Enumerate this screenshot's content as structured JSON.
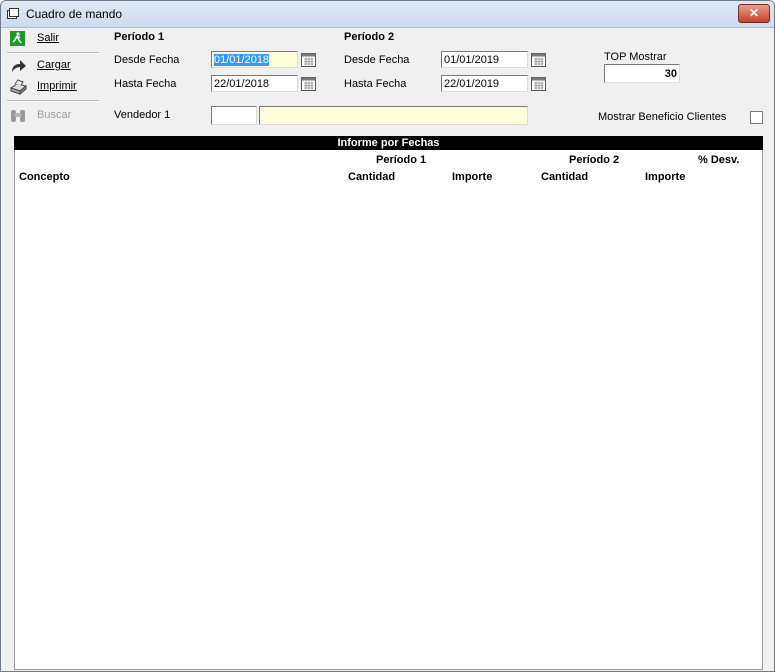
{
  "window": {
    "title": "Cuadro de mando",
    "close_label": "✕"
  },
  "toolbar": {
    "salir": "Salir",
    "cargar": "Cargar",
    "imprimir": "Imprimir",
    "buscar": "Buscar"
  },
  "periodo1": {
    "heading": "Período 1",
    "desde_label": "Desde Fecha",
    "desde_value": "01/01/2018",
    "hasta_label": "Hasta Fecha",
    "hasta_value": "22/01/2018"
  },
  "periodo2": {
    "heading": "Período 2",
    "desde_label": "Desde Fecha",
    "desde_value": "01/01/2019",
    "hasta_label": "Hasta Fecha",
    "hasta_value": "22/01/2019"
  },
  "top": {
    "label": "TOP Mostrar",
    "value": "30"
  },
  "vendedor": {
    "label": "Vendedor 1",
    "code": "",
    "name": ""
  },
  "beneficio": {
    "label": "Mostrar Beneficio Clientes",
    "checked": false
  },
  "report": {
    "title": "Informe por Fechas",
    "periodo1": "Período 1",
    "periodo2": "Período 2",
    "desv": "% Desv.",
    "concepto": "Concepto",
    "cantidad1": "Cantidad",
    "importe1": "Importe",
    "cantidad2": "Cantidad",
    "importe2": "Importe"
  },
  "colors": {
    "selection": "#3399ff",
    "input_yellow": "#ffffd8",
    "report_header": "#000000"
  }
}
